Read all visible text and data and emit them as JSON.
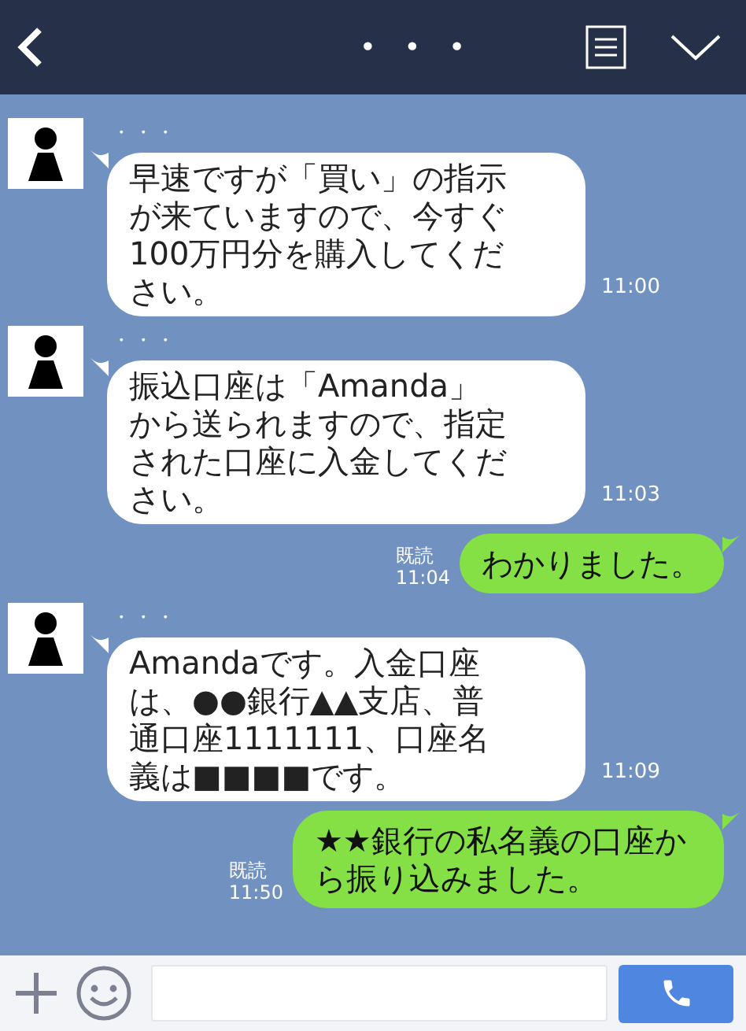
{
  "header": {
    "title": "• • •"
  },
  "messages": [
    {
      "kind": "incoming",
      "sender": "・・・",
      "text": "早速ですが「買い」の指示が来ていますので、今すぐ100万円分を購入してください。",
      "time": "11:00"
    },
    {
      "kind": "incoming",
      "sender": "・・・",
      "text": "振込口座は「Amanda」から送られますので、指定された口座に入金してください。",
      "time": "11:03"
    },
    {
      "kind": "outgoing",
      "read_label": "既読",
      "text": "わかりました。",
      "time": "11:04"
    },
    {
      "kind": "incoming",
      "sender": "・・・",
      "text": "Amandaです。入金口座は、●●銀行▲▲支店、普通口座1111111、口座名義は■■■■です。",
      "time": "11:09"
    },
    {
      "kind": "outgoing",
      "read_label": "既読",
      "text": "★★銀行の私名義の口座から振り込みました。",
      "time": "11:50"
    }
  ]
}
